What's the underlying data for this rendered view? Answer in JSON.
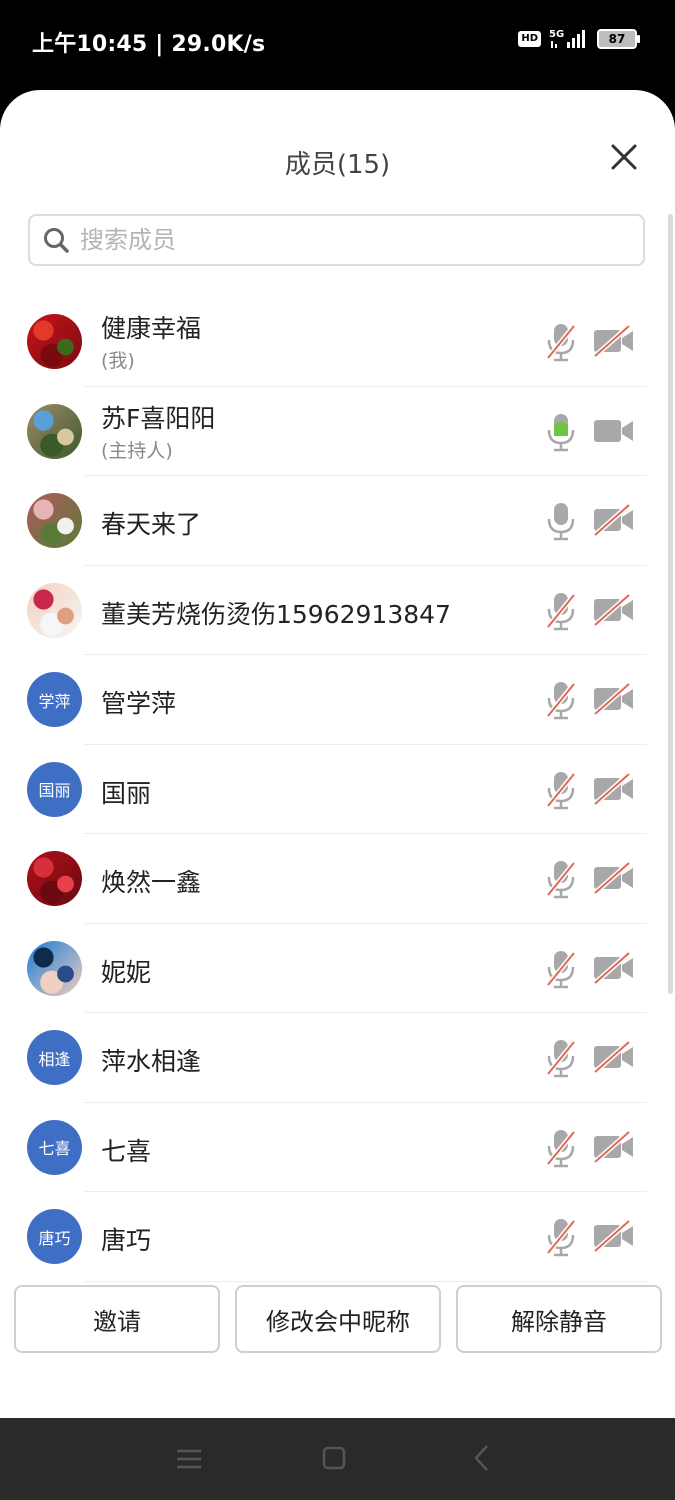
{
  "status_bar": {
    "time_speed": "上午10:45 | 29.0K/s",
    "hd_label": "HD",
    "network_label": "5G",
    "battery": "87"
  },
  "panel": {
    "title": "成员(15)",
    "search_placeholder": "搜索成员"
  },
  "members": [
    {
      "name": "健康幸福",
      "role": "(我)",
      "avatar": {
        "type": "photo",
        "colors": [
          "#c8151b",
          "#e23a2a",
          "#7a0a10",
          "#3a6a1a"
        ]
      },
      "mic": "muted",
      "camera": "off"
    },
    {
      "name": "苏F喜阳阳",
      "role": "(主持人)",
      "avatar": {
        "type": "photo",
        "colors": [
          "#a08a6a",
          "#5aa0d8",
          "#3a5a2a",
          "#d8c8a0"
        ]
      },
      "mic": "speaking",
      "camera": "on"
    },
    {
      "name": "春天来了",
      "role": "",
      "avatar": {
        "type": "photo",
        "colors": [
          "#b25a5a",
          "#e6b4b4",
          "#5a7a3a",
          "#f0f0f0"
        ]
      },
      "mic": "on",
      "camera": "off"
    },
    {
      "name": "董美芳烧伤烫伤15962913847",
      "role": "",
      "avatar": {
        "type": "photo",
        "colors": [
          "#f2d0c0",
          "#c8284a",
          "#f6f6f6",
          "#e0a080"
        ]
      },
      "mic": "muted",
      "camera": "off"
    },
    {
      "name": "管学萍",
      "role": "",
      "avatar": {
        "type": "text",
        "text": "学萍"
      },
      "mic": "muted",
      "camera": "off"
    },
    {
      "name": "国丽",
      "role": "",
      "avatar": {
        "type": "text",
        "text": "国丽"
      },
      "mic": "muted",
      "camera": "off"
    },
    {
      "name": "焕然一鑫",
      "role": "",
      "avatar": {
        "type": "photo",
        "colors": [
          "#b0101a",
          "#d8303a",
          "#6a0a10",
          "#e84048"
        ]
      },
      "mic": "muted",
      "camera": "off"
    },
    {
      "name": "妮妮",
      "role": "",
      "avatar": {
        "type": "photo",
        "colors": [
          "#1a7ad8",
          "#102a4a",
          "#f0d0c0",
          "#2a4a8a"
        ]
      },
      "mic": "muted",
      "camera": "off"
    },
    {
      "name": "萍水相逢",
      "role": "",
      "avatar": {
        "type": "text",
        "text": "相逢"
      },
      "mic": "muted",
      "camera": "off"
    },
    {
      "name": "七喜",
      "role": "",
      "avatar": {
        "type": "text",
        "text": "七喜"
      },
      "mic": "muted",
      "camera": "off"
    },
    {
      "name": "唐巧",
      "role": "",
      "avatar": {
        "type": "text",
        "text": "唐巧"
      },
      "mic": "muted",
      "camera": "off"
    }
  ],
  "actions": {
    "invite": "邀请",
    "rename": "修改会中昵称",
    "unmute": "解除静音"
  },
  "colors": {
    "accent_blue": "#3f6fc4",
    "speaking_green": "#6cc644",
    "muted_red": "#e0685a",
    "icon_gray": "#a8a8a8"
  }
}
